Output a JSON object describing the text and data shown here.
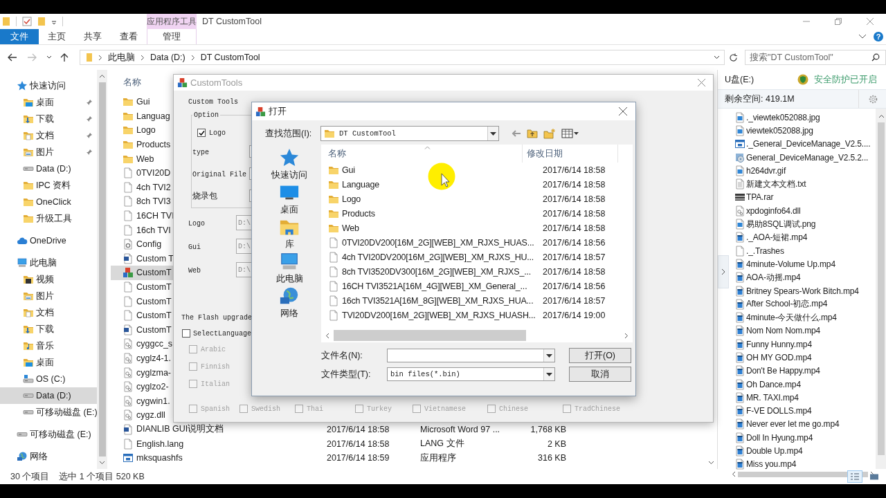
{
  "window": {
    "title": "DT CustomTool",
    "context_group": "应用程序工具",
    "help": "?"
  },
  "ribbon_tabs": [
    {
      "label": "文件",
      "kind": "file"
    },
    {
      "label": "主页",
      "kind": "normal"
    },
    {
      "label": "共享",
      "kind": "normal"
    },
    {
      "label": "查看",
      "kind": "normal"
    },
    {
      "label": "管理",
      "kind": "context"
    }
  ],
  "address": {
    "path": [
      "此电脑",
      "Data (D:)",
      "DT CustomTool"
    ],
    "search_placeholder": "搜索\"DT CustomTool\""
  },
  "nav": [
    {
      "label": "快速访问",
      "kind": "star",
      "selected": false,
      "children": [
        {
          "label": "桌面",
          "kind": "desktop",
          "pinned": true,
          "selected": false
        },
        {
          "label": "下载",
          "kind": "download",
          "pinned": true,
          "selected": false
        },
        {
          "label": "文档",
          "kind": "docfolder",
          "pinned": true,
          "selected": false
        },
        {
          "label": "图片",
          "kind": "picfolder",
          "pinned": true,
          "selected": false
        },
        {
          "label": "Data (D:)",
          "kind": "drive",
          "pinned": false,
          "selected": false
        },
        {
          "label": "IPC 资料",
          "kind": "folder",
          "pinned": false,
          "selected": false
        },
        {
          "label": "OneClick",
          "kind": "folder",
          "pinned": false,
          "selected": false
        },
        {
          "label": "升级工具",
          "kind": "folder",
          "pinned": false,
          "selected": false
        }
      ]
    },
    {
      "label": "OneDrive",
      "kind": "cloud",
      "selected": false
    },
    {
      "label": "此电脑",
      "kind": "computer",
      "selected": false,
      "children": [
        {
          "label": "视频",
          "kind": "videofolder",
          "selected": false
        },
        {
          "label": "图片",
          "kind": "picfolder",
          "selected": false
        },
        {
          "label": "文档",
          "kind": "docfolder",
          "selected": false
        },
        {
          "label": "下载",
          "kind": "download",
          "selected": false
        },
        {
          "label": "音乐",
          "kind": "music",
          "selected": false
        },
        {
          "label": "桌面",
          "kind": "desktop",
          "selected": false
        },
        {
          "label": "OS (C:)",
          "kind": "osdrive",
          "selected": false
        },
        {
          "label": "Data (D:)",
          "kind": "drive",
          "selected": true
        },
        {
          "label": "可移动磁盘 (E:)",
          "kind": "drive",
          "selected": false
        }
      ]
    },
    {
      "label": "可移动磁盘 (E:)",
      "kind": "drive",
      "selected": false
    },
    {
      "label": "网络",
      "kind": "network",
      "selected": false
    }
  ],
  "files": {
    "columns": [
      "名称"
    ],
    "rows": [
      {
        "name": "Gui",
        "kind": "folder",
        "selected": false
      },
      {
        "name": "Languag",
        "kind": "folder",
        "selected": false
      },
      {
        "name": "Logo",
        "kind": "folder",
        "selected": false
      },
      {
        "name": "Products",
        "kind": "folder",
        "selected": false
      },
      {
        "name": "Web",
        "kind": "folder",
        "selected": false
      },
      {
        "name": "0TVI20D",
        "kind": "file",
        "selected": false
      },
      {
        "name": "4ch TVI2",
        "kind": "file",
        "selected": false
      },
      {
        "name": "8ch TVI3",
        "kind": "file",
        "selected": false
      },
      {
        "name": "16CH TVI",
        "kind": "file",
        "selected": false
      },
      {
        "name": "16ch TVI",
        "kind": "file",
        "selected": false
      },
      {
        "name": "Config",
        "kind": "settings",
        "selected": false
      },
      {
        "name": "Custom T",
        "kind": "document",
        "selected": false
      },
      {
        "name": "CustomT",
        "kind": "app",
        "selected": true
      },
      {
        "name": "CustomT",
        "kind": "file",
        "selected": false
      },
      {
        "name": "CustomT",
        "kind": "file",
        "selected": false
      },
      {
        "name": "CustomT",
        "kind": "file",
        "selected": false
      },
      {
        "name": "CustomT",
        "kind": "document",
        "selected": false
      },
      {
        "name": "cyggcc_s",
        "kind": "dll",
        "selected": false
      },
      {
        "name": "cyglz4-1.",
        "kind": "dll",
        "selected": false
      },
      {
        "name": "cyglzma-",
        "kind": "dll",
        "selected": false
      },
      {
        "name": "cyglzo2-",
        "kind": "dll",
        "selected": false
      },
      {
        "name": "cygwin1.",
        "kind": "dll",
        "selected": false
      },
      {
        "name": "cygz.dll",
        "kind": "dll",
        "selected": false
      },
      {
        "name": "DIANLIB GUI说明文档",
        "kind": "document",
        "selected": false,
        "date": "2017/6/14 18:58",
        "type": "Microsoft Word 97 ...",
        "size": "1,768 KB"
      },
      {
        "name": "English.lang",
        "kind": "file",
        "selected": false,
        "date": "2017/6/14 18:58",
        "type": "LANG 文件",
        "size": "2 KB"
      },
      {
        "name": "mksquashfs",
        "kind": "program",
        "selected": false,
        "date": "2017/6/14 18:59",
        "type": "应用程序",
        "size": "316 KB"
      }
    ]
  },
  "status_bar": [
    "30 个项目",
    "选中 1 个项目  520 KB"
  ],
  "custom_tools": {
    "title": "CustomTools",
    "heading": "Custom Tools",
    "group": "Option",
    "logo_option": {
      "label": "Logo",
      "checked": true
    },
    "option_rows": [
      "type",
      "Original File",
      "烧录包"
    ],
    "paths": [
      {
        "label": "Logo",
        "value": "D:\\"
      },
      {
        "label": "Gui",
        "value": "D:\\"
      },
      {
        "label": "Web",
        "value": "D:\\"
      }
    ],
    "flash_label": "The Flash upgrade",
    "select_language": {
      "label": "SelectLanguage",
      "checked": false
    },
    "language_rows": [
      [
        {
          "label": "Arabic",
          "checked": false
        }
      ],
      [
        {
          "label": "Finnish",
          "checked": false
        }
      ],
      [
        {
          "label": "Italian",
          "checked": false
        }
      ],
      [
        {
          "label": "Spanish",
          "checked": false
        },
        {
          "label": "Swedish",
          "checked": false
        },
        {
          "label": "Thai",
          "checked": false
        },
        {
          "label": "Turkey",
          "checked": false
        },
        {
          "label": "Vietnamese",
          "checked": false
        },
        {
          "label": "Chinese",
          "checked": false
        },
        {
          "label": "TradChinese",
          "checked": false
        }
      ]
    ]
  },
  "open_dialog": {
    "title": "打开",
    "look_in_label": "查找范围(I):",
    "look_in": "DT CustomTool",
    "places": [
      {
        "label": "快速访问",
        "kind": "star"
      },
      {
        "label": "桌面",
        "kind": "screen"
      },
      {
        "label": "库",
        "kind": "library"
      },
      {
        "label": "此电脑",
        "kind": "computer"
      },
      {
        "label": "网络",
        "kind": "network"
      }
    ],
    "columns": [
      "名称",
      "修改日期"
    ],
    "rows": [
      {
        "name": "Gui",
        "kind": "folder",
        "date": "2017/6/14 18:58"
      },
      {
        "name": "Language",
        "kind": "folder",
        "date": "2017/6/14 18:58"
      },
      {
        "name": "Logo",
        "kind": "folder",
        "date": "2017/6/14 18:58"
      },
      {
        "name": "Products",
        "kind": "folder",
        "date": "2017/6/14 18:58"
      },
      {
        "name": "Web",
        "kind": "folder",
        "date": "2017/6/14 18:58"
      },
      {
        "name": "0TVI20DV200[16M_2G][WEB]_XM_RJXS_HUAS...",
        "kind": "file",
        "date": "2017/6/14 18:56"
      },
      {
        "name": "4ch TVI20DV200[16M_2G][WEB]_XM_RJXS_HU...",
        "kind": "file",
        "date": "2017/6/14 18:57"
      },
      {
        "name": "8ch TVI3520DV300[16M_2G][WEB]_XM_RJXS_...",
        "kind": "file",
        "date": "2017/6/14 18:58"
      },
      {
        "name": "16CH TVI3521A[16M_4G][WEB]_XM_General_...",
        "kind": "file",
        "date": "2017/6/14 18:56"
      },
      {
        "name": "16ch TVI3521A[16M_8G][WEB]_XM_RJXS_HUA...",
        "kind": "file",
        "date": "2017/6/14 18:57"
      },
      {
        "name": "TVI20DV200[16M_2G][WEB]_XM_RJXS_HUASH...",
        "kind": "file",
        "date": "2017/6/14 19:00"
      }
    ],
    "filename_label": "文件名(N):",
    "filetype_label": "文件类型(T):",
    "filetype": "bin files(*.bin)",
    "buttons": [
      "打开(O)",
      "取消"
    ]
  },
  "usb_panel": {
    "title": "U盘(E:)",
    "protection": "安全防护已开启",
    "free_space": "剩余空间: 419.1M",
    "files": [
      {
        "name": "._viewtek052088.jpg",
        "kind": "image"
      },
      {
        "name": "viewtek052088.jpg",
        "kind": "image"
      },
      {
        "name": "._General_DeviceManage_V2.5....",
        "kind": "program"
      },
      {
        "name": "General_DeviceManage_V2.5.2...",
        "kind": "setup"
      },
      {
        "name": "h264dvr.gif",
        "kind": "image"
      },
      {
        "name": "新建文本文档.txt",
        "kind": "text"
      },
      {
        "name": "TPA.rar",
        "kind": "archive"
      },
      {
        "name": "xpdoginfo64.dll",
        "kind": "dll"
      },
      {
        "name": "易助8SQL调试.png",
        "kind": "image"
      },
      {
        "name": "._AOA-短裙.mp4",
        "kind": "video"
      },
      {
        "name": "._.Trashes",
        "kind": "file"
      },
      {
        "name": "4minute-Volume Up.mp4",
        "kind": "video"
      },
      {
        "name": "AOA-动摇.mp4",
        "kind": "video"
      },
      {
        "name": "Britney Spears-Work Bitch.mp4",
        "kind": "video"
      },
      {
        "name": "After School-初恋.mp4",
        "kind": "video"
      },
      {
        "name": "4minute-今天做什么.mp4",
        "kind": "video"
      },
      {
        "name": "Nom Nom Nom.mp4",
        "kind": "video"
      },
      {
        "name": "Funny Hunny.mp4",
        "kind": "video"
      },
      {
        "name": "OH MY GOD.mp4",
        "kind": "video"
      },
      {
        "name": "Don't Be Happy.mp4",
        "kind": "video"
      },
      {
        "name": "Oh Dance.mp4",
        "kind": "video"
      },
      {
        "name": "MR. TAXI.mp4",
        "kind": "video"
      },
      {
        "name": "F-VE DOLLS.mp4",
        "kind": "video"
      },
      {
        "name": "Never ever let me go.mp4",
        "kind": "video"
      },
      {
        "name": "Doll In Hyung.mp4",
        "kind": "video"
      },
      {
        "name": "Double Up.mp4",
        "kind": "video"
      },
      {
        "name": "Miss you.mp4",
        "kind": "video"
      }
    ]
  }
}
